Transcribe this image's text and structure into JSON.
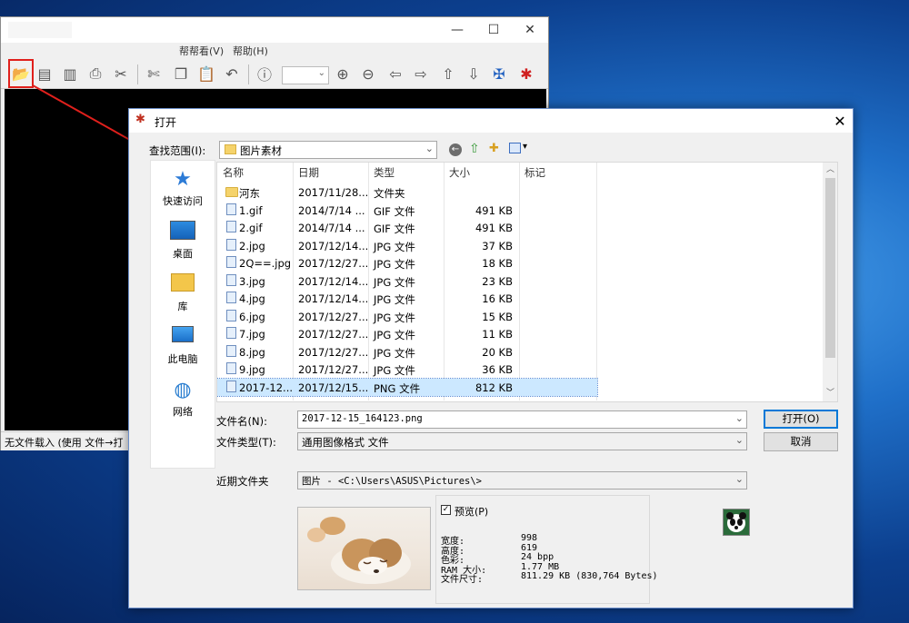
{
  "bg_app": {
    "menu": {
      "help_view": "帮帮看(V)",
      "help": "帮助(H)"
    },
    "status": "无文件载入 (使用 文件→打"
  },
  "dialog": {
    "title": "打开",
    "look_in_label": "查找范围(I):",
    "look_in_value": "图片素材",
    "places": [
      {
        "label": "快速访问",
        "icon": "quick-access-star-icon"
      },
      {
        "label": "桌面",
        "icon": "desktop-icon"
      },
      {
        "label": "库",
        "icon": "library-icon"
      },
      {
        "label": "此电脑",
        "icon": "computer-icon"
      },
      {
        "label": "网络",
        "icon": "network-icon"
      }
    ],
    "columns": {
      "name": "名称",
      "date": "日期",
      "type": "类型",
      "size": "大小",
      "tags": "标记"
    },
    "files": [
      {
        "name": "河东",
        "date": "2017/11/28...",
        "type": "文件夹",
        "size": "",
        "folder": true
      },
      {
        "name": "1.gif",
        "date": "2014/7/14 ...",
        "type": "GIF 文件",
        "size": "491 KB"
      },
      {
        "name": "2.gif",
        "date": "2014/7/14 ...",
        "type": "GIF 文件",
        "size": "491 KB"
      },
      {
        "name": "2.jpg",
        "date": "2017/12/14...",
        "type": "JPG 文件",
        "size": "37 KB"
      },
      {
        "name": "2Q==.jpg",
        "date": "2017/12/27...",
        "type": "JPG 文件",
        "size": "18 KB"
      },
      {
        "name": "3.jpg",
        "date": "2017/12/14...",
        "type": "JPG 文件",
        "size": "23 KB"
      },
      {
        "name": "4.jpg",
        "date": "2017/12/14...",
        "type": "JPG 文件",
        "size": "16 KB"
      },
      {
        "name": "6.jpg",
        "date": "2017/12/27...",
        "type": "JPG 文件",
        "size": "15 KB"
      },
      {
        "name": "7.jpg",
        "date": "2017/12/27...",
        "type": "JPG 文件",
        "size": "11 KB"
      },
      {
        "name": "8.jpg",
        "date": "2017/12/27...",
        "type": "JPG 文件",
        "size": "20 KB"
      },
      {
        "name": "9.jpg",
        "date": "2017/12/27...",
        "type": "JPG 文件",
        "size": "36 KB"
      },
      {
        "name": "2017-12...",
        "date": "2017/12/15...",
        "type": "PNG 文件",
        "size": "812 KB",
        "selected": true
      }
    ],
    "filename_label": "文件名(N):",
    "filename_value": "2017-12-15_164123.png",
    "filetype_label": "文件类型(T):",
    "filetype_value": "通用图像格式 文件",
    "open_button": "打开(O)",
    "cancel_button": "取消",
    "recent_label": "近期文件夹",
    "recent_value": "图片  -  <C:\\Users\\ASUS\\Pictures\\>",
    "preview_label": "预览(P)",
    "preview_checked": true,
    "info": [
      {
        "k": "宽度:",
        "v": "998"
      },
      {
        "k": "高度:",
        "v": "619"
      },
      {
        "k": "色彩:",
        "v": "24 bpp"
      },
      {
        "k": "RAM 大小:",
        "v": "1.77 MB"
      },
      {
        "k": "文件尺寸:",
        "v": "811.29 KB (830,764 Bytes)"
      }
    ]
  },
  "colors": {
    "annotation_red": "#e0201c",
    "selection": "#cce8ff",
    "accent": "#0078d7"
  }
}
